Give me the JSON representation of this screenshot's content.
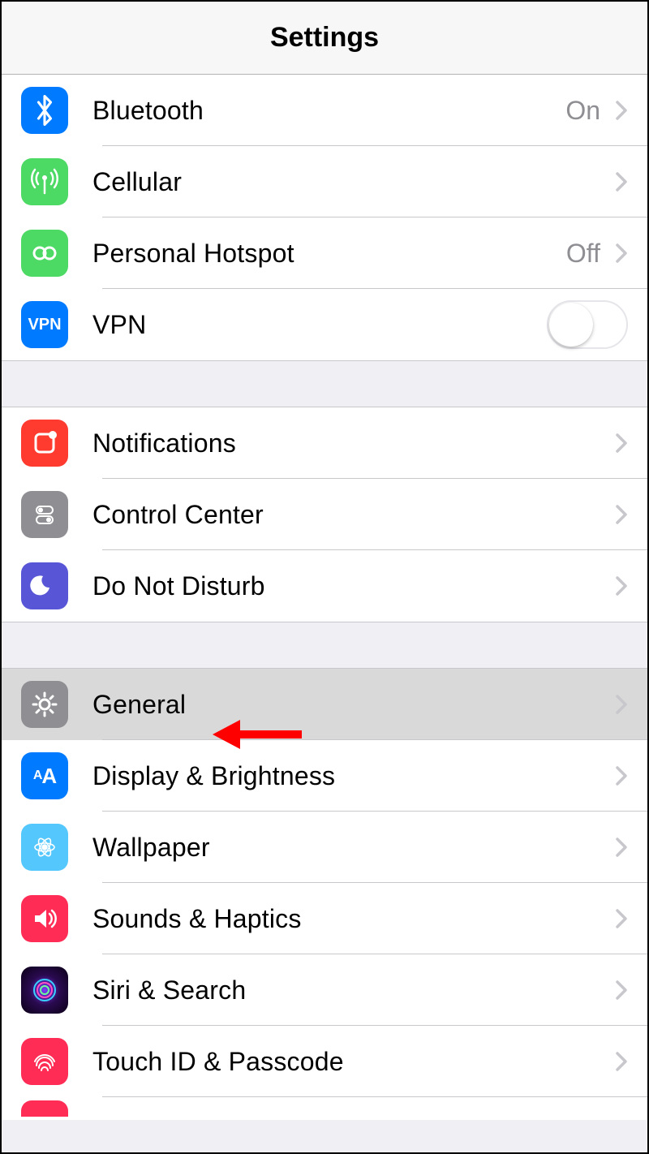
{
  "title": "Settings",
  "groups": [
    {
      "rows": [
        {
          "icon": "bluetooth",
          "label": "Bluetooth",
          "value": "On",
          "accessory": "chevron"
        },
        {
          "icon": "cellular",
          "label": "Cellular",
          "accessory": "chevron"
        },
        {
          "icon": "hotspot",
          "label": "Personal Hotspot",
          "value": "Off",
          "accessory": "chevron"
        },
        {
          "icon": "vpn",
          "label": "VPN",
          "accessory": "switch",
          "switch_on": false
        }
      ]
    },
    {
      "rows": [
        {
          "icon": "notifications",
          "label": "Notifications",
          "accessory": "chevron"
        },
        {
          "icon": "controlcenter",
          "label": "Control Center",
          "accessory": "chevron"
        },
        {
          "icon": "dnd",
          "label": "Do Not Disturb",
          "accessory": "chevron"
        }
      ]
    },
    {
      "rows": [
        {
          "icon": "general",
          "label": "General",
          "accessory": "chevron",
          "highlight": true,
          "annotated": true
        },
        {
          "icon": "display",
          "label": "Display & Brightness",
          "accessory": "chevron"
        },
        {
          "icon": "wallpaper",
          "label": "Wallpaper",
          "accessory": "chevron"
        },
        {
          "icon": "sounds",
          "label": "Sounds & Haptics",
          "accessory": "chevron"
        },
        {
          "icon": "siri",
          "label": "Siri & Search",
          "accessory": "chevron"
        },
        {
          "icon": "touchid",
          "label": "Touch ID & Passcode",
          "accessory": "chevron"
        }
      ]
    }
  ],
  "vpn_text": "VPN",
  "display_aa": "AA"
}
